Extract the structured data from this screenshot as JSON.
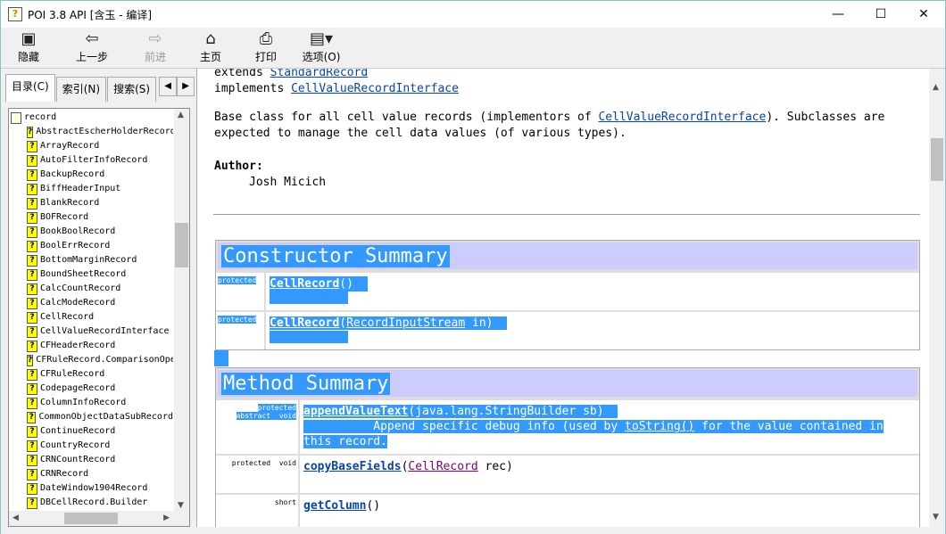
{
  "window": {
    "title": "POI 3.8 API [含玉 - 编译]",
    "icon": "help-file-icon",
    "controls": [
      "—",
      "☐",
      "✕"
    ]
  },
  "toolbar": {
    "items": [
      {
        "label": "隐藏",
        "icon": "hide-icon",
        "enabled": true
      },
      {
        "label": "上一步",
        "icon": "back-arrow-icon",
        "enabled": true
      },
      {
        "label": "前进",
        "icon": "forward-arrow-icon",
        "enabled": false
      },
      {
        "label": "主页",
        "icon": "home-icon",
        "enabled": true
      },
      {
        "label": "打印",
        "icon": "printer-icon",
        "enabled": true
      },
      {
        "label": "选项(O)",
        "icon": "options-icon",
        "enabled": true
      }
    ]
  },
  "sidebar": {
    "tabs": [
      "目录(C)",
      "索引(N)",
      "搜索(S)"
    ],
    "active_tab": 0,
    "root": "record",
    "items": [
      "AbstractEscherHolderRecord",
      "ArrayRecord",
      "AutoFilterInfoRecord",
      "BackupRecord",
      "BiffHeaderInput",
      "BlankRecord",
      "BOFRecord",
      "BookBoolRecord",
      "BoolErrRecord",
      "BottomMarginRecord",
      "BoundSheetRecord",
      "CalcCountRecord",
      "CalcModeRecord",
      "CellRecord",
      "CellValueRecordInterface",
      "CFHeaderRecord",
      "CFRuleRecord.ComparisonOperator",
      "CFRuleRecord",
      "CodepageRecord",
      "ColumnInfoRecord",
      "CommonObjectDataSubRecord",
      "ContinueRecord",
      "CountryRecord",
      "CRNCountRecord",
      "CRNRecord",
      "DateWindow1904Record",
      "DBCellRecord.Builder"
    ]
  },
  "content": {
    "extends_kw": "extends",
    "extends_link": "StandardRecord",
    "implements_kw": "implements",
    "implements_link": "CellValueRecordInterface",
    "desc_a": "Base class for all cell value records (implementors of ",
    "desc_link": "CellValueRecordInterface",
    "desc_b": "). Subclasses are expected to manage the cell data values (of various types).",
    "author_label": "Author:",
    "author": "Josh Micich",
    "constructor_title": "Constructor Summary",
    "constructors": [
      {
        "mod": "protected",
        "name": "CellRecord",
        "open": "(",
        "param_link": "",
        "param_rest": ")"
      },
      {
        "mod": "protected",
        "name": "CellRecord",
        "open": "(",
        "param_link": "RecordInputStream",
        "param_rest": " in)"
      }
    ],
    "method_title": "Method Summary",
    "methods": [
      {
        "mod1": "protected",
        "mod2": "abstract  void",
        "name": "appendValueText",
        "sig": "(java.lang.StringBuilder sb)",
        "desc_a": "Append specific debug info (used by ",
        "desc_link": "toString()",
        "desc_b": " for the value contained in this record."
      },
      {
        "mod1": "protected  void",
        "name": "copyBaseFields",
        "open": "(",
        "param_link": "CellRecord",
        "param_rest": " rec)"
      },
      {
        "mod1": "short",
        "name": "getColumn",
        "sig": "()"
      }
    ]
  }
}
